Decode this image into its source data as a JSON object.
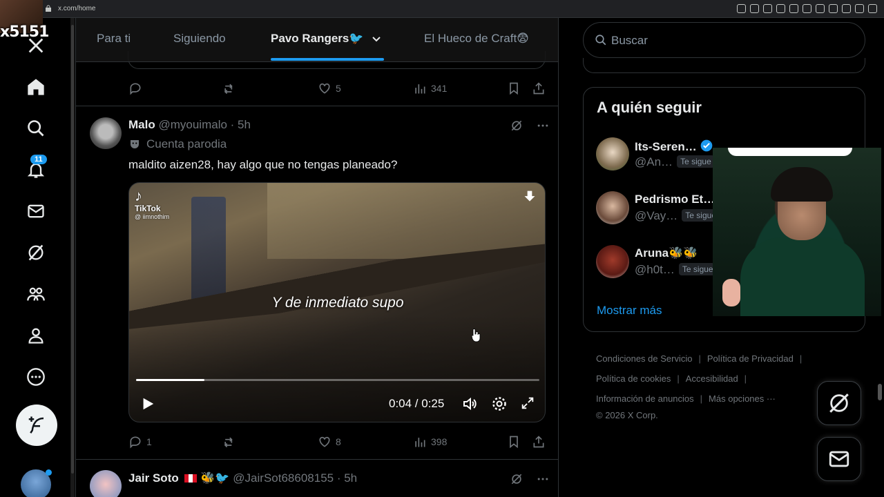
{
  "browser": {
    "url": "x.com/home"
  },
  "streamer": {
    "tag": "x5151"
  },
  "nav": {
    "notifications_badge": "11"
  },
  "tabs": [
    {
      "label": "Para ti"
    },
    {
      "label": "Siguiendo"
    },
    {
      "label": "Pavo Rangers🐦"
    },
    {
      "label": "El Hueco de Craft😨"
    }
  ],
  "prev_tweet": {
    "replies": "",
    "likes": "5",
    "views": "341"
  },
  "tweet": {
    "name": "Malo",
    "handle": "@myouimalo · 5h",
    "parody_label": "Cuenta parodia",
    "text": "maldito aizen28, hay algo que no tengas planeado?",
    "video": {
      "tiktok_label": "TikTok",
      "tiktok_handle": "@ iimnothim",
      "caption": "Y de inmediato supo",
      "time": "0:04 / 0:25",
      "progress": 0.17
    },
    "replies": "1",
    "likes": "8",
    "views": "398"
  },
  "tweet2": {
    "name": "Jair Soto",
    "emojis": "🐝🐦",
    "handle": "@JairSot68608155 · 5h"
  },
  "search": {
    "placeholder": "Buscar"
  },
  "who_to_follow": {
    "title": "A quién seguir",
    "items": [
      {
        "name": "Its-Seren…",
        "handle": "@An…",
        "badge": "Te sigue"
      },
      {
        "name": "Pedrismo Et…",
        "handle": "@Vay…",
        "badge": "Te sigue"
      },
      {
        "name": "Aruna🐝🐝",
        "handle": "@h0t…",
        "badge": "Te sigue"
      }
    ],
    "show_more": "Mostrar más"
  },
  "footer": {
    "links": [
      "Condiciones de Servicio",
      "Política de Privacidad",
      "Política de cookies",
      "Accesibilidad",
      "Información de anuncios",
      "Más opciones ···"
    ],
    "copyright": "© 2026 X Corp."
  },
  "colors": {
    "accent": "#1d9bf0",
    "background": "#000000",
    "muted": "#71767b"
  }
}
